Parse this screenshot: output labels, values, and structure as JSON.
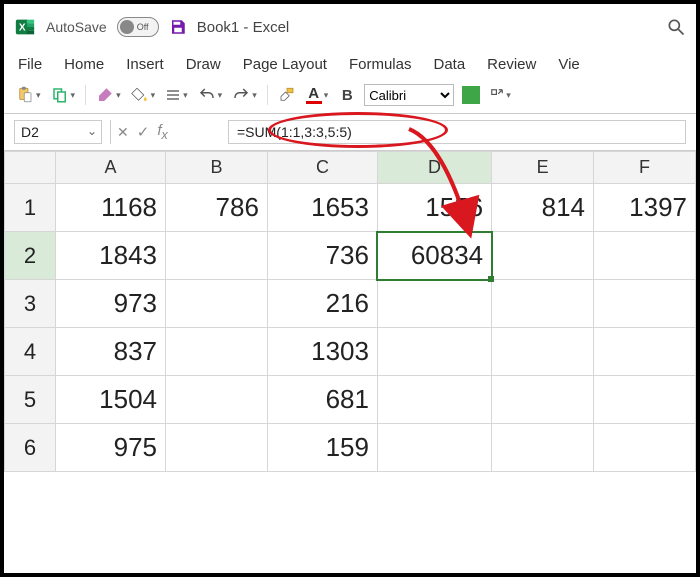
{
  "title": {
    "autosave": "AutoSave",
    "toggle_state": "Off",
    "doc": "Book1  -  Excel"
  },
  "menu": [
    "File",
    "Home",
    "Insert",
    "Draw",
    "Page Layout",
    "Formulas",
    "Data",
    "Review",
    "Vie"
  ],
  "toolbar": {
    "font_name": "Calibri",
    "bold": "B",
    "font_letter": "A"
  },
  "namebox": "D2",
  "formula": "=SUM(1:1,3:3,5:5)",
  "columns": [
    "A",
    "B",
    "C",
    "D",
    "E",
    "F"
  ],
  "rows": [
    "1",
    "2",
    "3",
    "4",
    "5",
    "6"
  ],
  "cells": {
    "r1": {
      "A": "1168",
      "B": "786",
      "C": "1653",
      "D": "1556",
      "E": "814",
      "F": "1397"
    },
    "r2": {
      "A": "1843",
      "B": "",
      "C": "736",
      "D": "60834",
      "E": "",
      "F": ""
    },
    "r3": {
      "A": "973",
      "B": "",
      "C": "216",
      "D": "",
      "E": "",
      "F": ""
    },
    "r4": {
      "A": "837",
      "B": "",
      "C": "1303",
      "D": "",
      "E": "",
      "F": ""
    },
    "r5": {
      "A": "1504",
      "B": "",
      "C": "681",
      "D": "",
      "E": "",
      "F": ""
    },
    "r6": {
      "A": "975",
      "B": "",
      "C": "159",
      "D": "",
      "E": "",
      "F": ""
    }
  }
}
